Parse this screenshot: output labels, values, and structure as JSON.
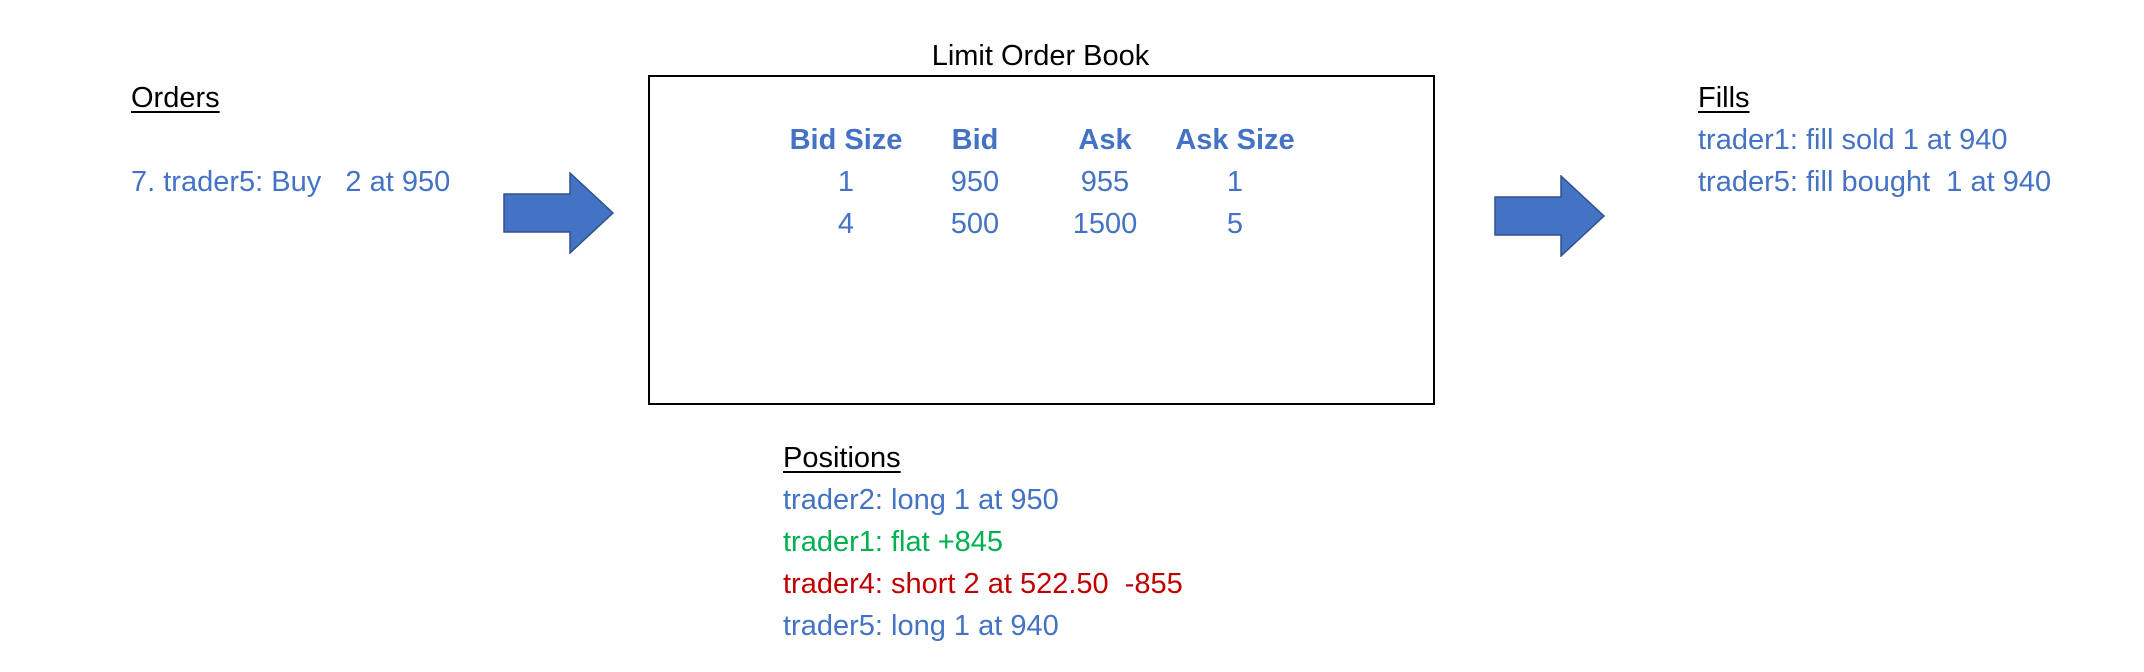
{
  "colors": {
    "blue": "#4472C4",
    "green": "#00B050",
    "red": "#C00000",
    "arrow": "#4472C4"
  },
  "orders": {
    "heading": "Orders",
    "lines": [
      "7. trader5: Buy   2 at 950"
    ]
  },
  "order_book": {
    "title": "Limit Order Book",
    "headers": {
      "bid_size": "Bid Size",
      "bid": "Bid",
      "ask": "Ask",
      "ask_size": "Ask Size"
    },
    "rows": [
      {
        "bid_size": "1",
        "bid": "950",
        "ask": "955",
        "ask_size": "1"
      },
      {
        "bid_size": "4",
        "bid": "500",
        "ask": "1500",
        "ask_size": "5"
      }
    ]
  },
  "fills": {
    "heading": "Fills",
    "lines": [
      "trader1: fill sold 1 at 940",
      "trader5: fill bought  1 at 940"
    ]
  },
  "positions": {
    "heading": "Positions",
    "lines": [
      {
        "text": "trader2: long 1 at 950",
        "color": "blue"
      },
      {
        "text": "trader1: flat +845",
        "color": "green"
      },
      {
        "text": "trader4: short 2 at 522.50  -855",
        "color": "red"
      },
      {
        "text": "trader5: long 1 at 940",
        "color": "blue"
      }
    ]
  },
  "arrows": {
    "left_icon": "right-arrow-icon",
    "right_icon": "right-arrow-icon"
  }
}
